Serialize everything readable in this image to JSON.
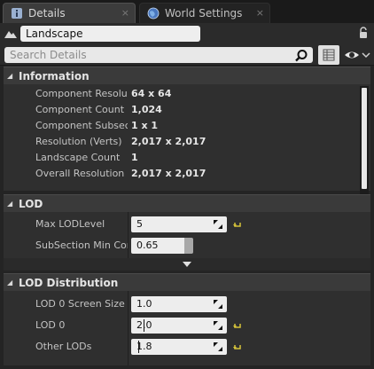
{
  "tabs": [
    {
      "label": "Details",
      "icon": "info-icon"
    },
    {
      "label": "World Settings",
      "icon": "globe-icon"
    }
  ],
  "tab_close_glyph": "×",
  "actor": {
    "name": "Landscape"
  },
  "search": {
    "placeholder": "Search Details"
  },
  "sections": {
    "information": {
      "title": "Information",
      "rows": [
        {
          "label": "Component Resolution",
          "value": "64 x 64"
        },
        {
          "label": "Component Count",
          "value": "1,024"
        },
        {
          "label": "Component Subsections",
          "value": "1 x 1"
        },
        {
          "label": "Resolution (Verts)",
          "value": "2,017 x 2,017"
        },
        {
          "label": "Landscape Count",
          "value": "1"
        },
        {
          "label": "Overall Resolution (Verts)",
          "value": "2,017 x 2,017"
        }
      ]
    },
    "lod": {
      "title": "LOD",
      "rows": [
        {
          "label": "Max LODLevel",
          "value": "5"
        },
        {
          "label": "SubSection Min Component Screen Size",
          "value": "0.65"
        }
      ]
    },
    "lod_distribution": {
      "title": "LOD Distribution",
      "rows": [
        {
          "label": "LOD 0 Screen Size",
          "value": "1.0"
        },
        {
          "label": "LOD 0",
          "value": "2.0"
        },
        {
          "label": "Other LODs",
          "value": "1.8"
        }
      ]
    }
  },
  "colors": {
    "panel_bg": "#242424",
    "section_header": "#3a3a3a",
    "row_bg": "#2f2f2f",
    "input_bg": "#ededed",
    "reset_arrow": "#d6c43a"
  }
}
